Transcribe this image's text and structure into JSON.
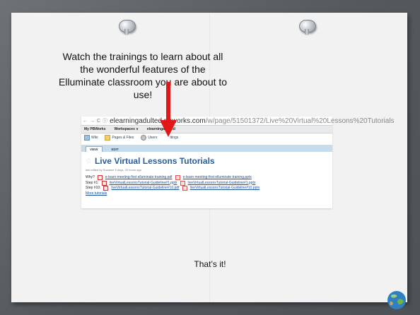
{
  "slide": {
    "intro_text": "Watch the trainings to learn about all the wonderful features of the Elluminate classroom you are about to use!",
    "outro_text": "That’s it!"
  },
  "browser": {
    "url_host": "elearningadulted.pbworks.com",
    "url_path": "/w/page/51501372/Live%20Virtual%20Lessons%20Tutorials"
  },
  "pbworks": {
    "menubar": {
      "my_pbworks": "My PBWorks",
      "workspaces": "Workspaces ∨",
      "workspace_name": "elearningadulted"
    },
    "tabs": [
      {
        "label": "Wiki"
      },
      {
        "label": "Pages & Files"
      },
      {
        "label": "Users"
      },
      {
        "label": "ttings"
      }
    ],
    "view_tabs": [
      {
        "label": "VIEW"
      },
      {
        "label": "EDIT"
      }
    ],
    "page_title": "Live Virtual Lessons Tutorials",
    "last_edited": "last edited by Suzanne 6 days, 20 hours ago",
    "rows": [
      {
        "prefix": "Why?",
        "link1": "e-learn meeting-first elluminate training.pdf",
        "link2": "e-learn meeting-first elluminate training.pptx"
      },
      {
        "prefix": "Step #1:",
        "link1": "liveVirtualLessonsTutorial-Guideline#1.pptx",
        "link2": "liveVirtualLessonsTutorial-Guideline#1.pptx"
      },
      {
        "prefix": "Step #10:",
        "link1": "liveVirtualLessonsTutorial-Guideline#10.pdf",
        "link2": "liveVirtualLessonsTutorial-Guideline#10.pptx"
      }
    ],
    "more_link": "More tutorials"
  },
  "colors": {
    "accent": "#2a5d9a",
    "arrow": "#e01818",
    "paper": "#f1f2f1",
    "background": "#5a5f63"
  },
  "icons": [
    "pushpin-icon",
    "arrow-down-icon",
    "back-icon",
    "forward-icon",
    "reload-icon",
    "lock-icon",
    "wiki-icon",
    "files-icon",
    "users-icon",
    "star-icon",
    "pdf-icon",
    "pptx-icon",
    "globe-icon"
  ]
}
